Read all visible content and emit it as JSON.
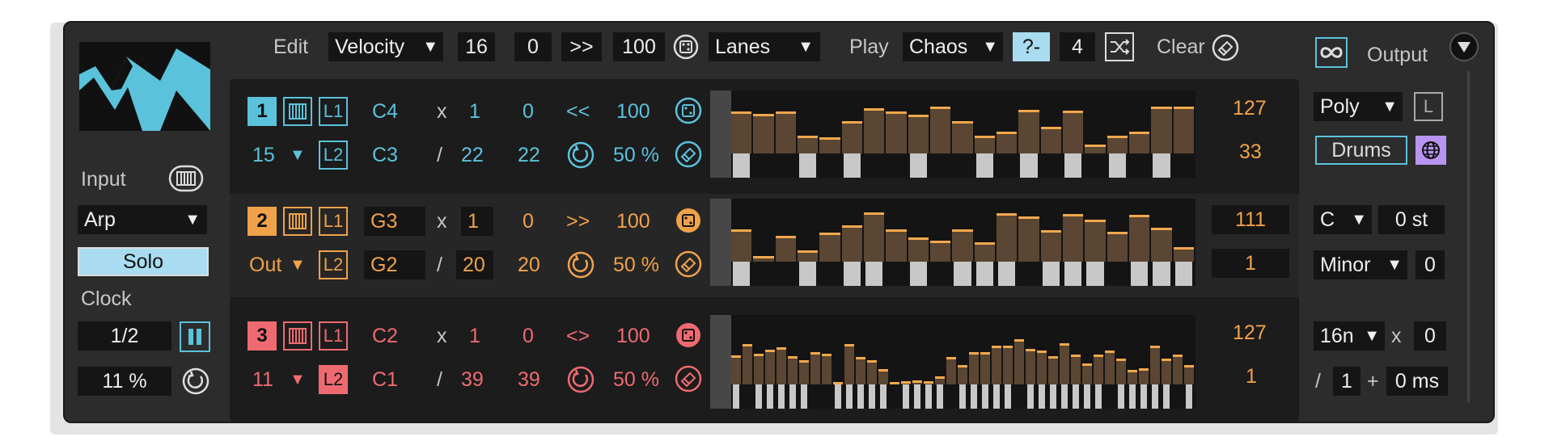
{
  "header": {
    "edit_label": "Edit",
    "edit_mode": "Velocity",
    "steps": "16",
    "offset": "0",
    "direction": ">>",
    "amount": "100",
    "lanes_label": "Lanes",
    "play_label": "Play",
    "play_mode": "Chaos",
    "chaos_op": "?-",
    "chaos_value": "4",
    "clear_label": "Clear"
  },
  "input": {
    "label": "Input",
    "mode": "Arp",
    "solo": "Solo",
    "clock_label": "Clock",
    "clock_rate": "1/2",
    "swing": "11 %"
  },
  "lanes": [
    {
      "index": "1",
      "channel": "15",
      "l1": "L1",
      "l2": "L2",
      "note1": "C4",
      "note2": "C3",
      "op1": "x",
      "op2": "/",
      "mul": "1",
      "div": "22",
      "offset": "0",
      "length": "22",
      "direction": "<<",
      "amount": "100",
      "prob": "50 %",
      "max": "127",
      "min": "33",
      "color": "#5bc2dc",
      "values": [
        0.72,
        0.68,
        0.72,
        0.3,
        0.28,
        0.55,
        0.78,
        0.72,
        0.66,
        0.8,
        0.55,
        0.3,
        0.38,
        0.75,
        0.46,
        0.73,
        0.15,
        0.3,
        0.38,
        0.8,
        0.81
      ],
      "gates": [
        1,
        0,
        0,
        1,
        0,
        1,
        0,
        0,
        1,
        0,
        0,
        1,
        0,
        1,
        0,
        1,
        0,
        1,
        0,
        1,
        0
      ]
    },
    {
      "index": "2",
      "channel": "Out",
      "l1": "L1",
      "l2": "L2",
      "note1": "G3",
      "note2": "G2",
      "op1": "x",
      "op2": "/",
      "mul": "1",
      "div": "20",
      "offset": "0",
      "length": "20",
      "direction": ">>",
      "amount": "100",
      "prob": "50 %",
      "max": "111",
      "min": "1",
      "color": "#f0a24a",
      "values": [
        0.55,
        0.1,
        0.45,
        0.2,
        0.5,
        0.62,
        0.85,
        0.55,
        0.42,
        0.36,
        0.55,
        0.33,
        0.84,
        0.78,
        0.54,
        0.82,
        0.72,
        0.52,
        0.8,
        0.58,
        0.25
      ],
      "gates": [
        1,
        0,
        0,
        1,
        0,
        1,
        1,
        0,
        1,
        0,
        1,
        1,
        1,
        0,
        1,
        1,
        1,
        0,
        1,
        1,
        1
      ]
    },
    {
      "index": "3",
      "channel": "11",
      "l1": "L1",
      "l2": "L2",
      "note1": "C2",
      "note2": "C1",
      "op1": "x",
      "op2": "/",
      "mul": "1",
      "div": "39",
      "offset": "0",
      "length": "39",
      "direction": "<>",
      "amount": "100",
      "prob": "50 %",
      "max": "127",
      "min": "1",
      "color": "#ef6a70",
      "values": [
        0.45,
        0.62,
        0.48,
        0.54,
        0.58,
        0.44,
        0.38,
        0.5,
        0.48,
        0.04,
        0.62,
        0.42,
        0.38,
        0.24,
        0.03,
        0.05,
        0.06,
        0.05,
        0.12,
        0.43,
        0.3,
        0.5,
        0.5,
        0.6,
        0.6,
        0.7,
        0.55,
        0.52,
        0.44,
        0.64,
        0.46,
        0.32,
        0.46,
        0.52,
        0.4,
        0.22,
        0.25,
        0.6,
        0.4,
        0.46,
        0.3
      ],
      "gates": [
        1,
        0,
        1,
        1,
        1,
        1,
        1,
        0,
        0,
        1,
        1,
        1,
        1,
        1,
        0,
        1,
        1,
        1,
        1,
        0,
        1,
        1,
        1,
        1,
        1,
        0,
        1,
        1,
        1,
        1,
        1,
        1,
        1,
        0,
        1,
        1,
        1,
        1,
        1,
        0,
        1
      ]
    }
  ],
  "output": {
    "label": "Output",
    "mode": "Poly",
    "lock": "L",
    "drums": "Drums",
    "root": "C",
    "transpose": "0 st",
    "scale": "Minor",
    "scale_value": "0",
    "rate": "16n",
    "rate_op": "x",
    "rate_mul": "0",
    "div_op": "/",
    "div": "1",
    "plus": "+",
    "delay": "0 ms"
  }
}
